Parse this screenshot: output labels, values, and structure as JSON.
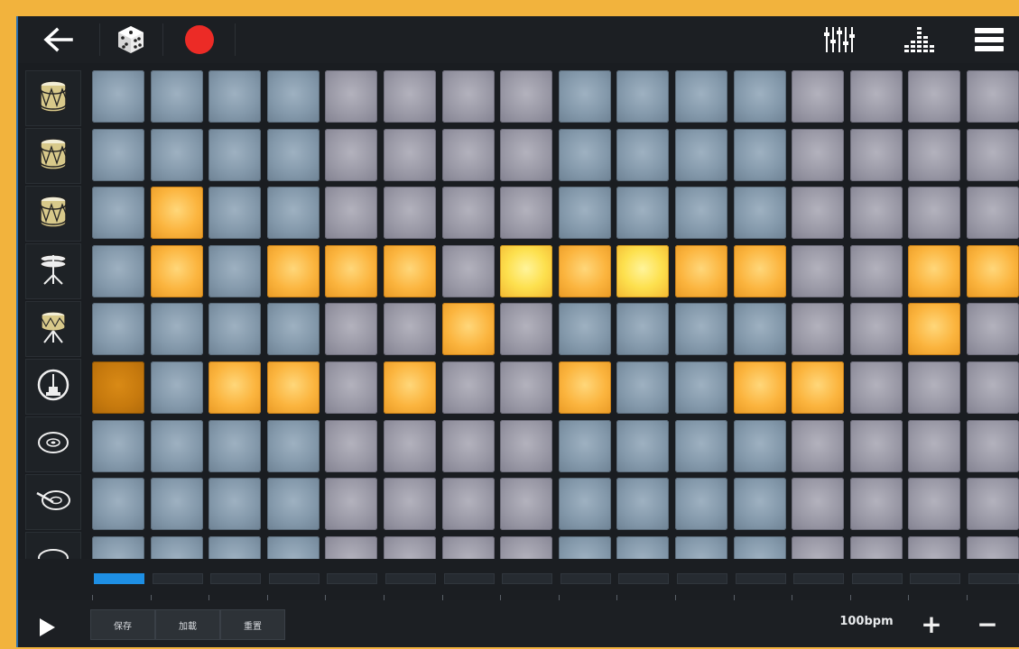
{
  "topbar": {
    "back_icon": "arrow-left-icon",
    "random_icon": "dice-icon",
    "record_icon": "record-icon",
    "mixer_icon": "mixer-sliders-icon",
    "equalizer_icon": "equalizer-icon",
    "menu_icon": "hamburger-menu-icon"
  },
  "instruments": [
    {
      "name": "drum-1-icon"
    },
    {
      "name": "drum-2-icon"
    },
    {
      "name": "drum-3-icon"
    },
    {
      "name": "hihat-icon"
    },
    {
      "name": "snare-stand-icon"
    },
    {
      "name": "kick-icon"
    },
    {
      "name": "cymbal-icon"
    },
    {
      "name": "ride-cymbal-icon"
    },
    {
      "name": "crash-cymbal-icon"
    }
  ],
  "grid": {
    "columns": 16,
    "rows": [
      "bbbbggggbbbbgggg",
      "bbbbggggbbbbgggg",
      "bObbggggbbbbgggg",
      "bObOOOgYOYOOggOO",
      "bbbbggOgbbbbggOg",
      "DbOOgOggObbOOggg",
      "bbbbggggbbbbgggg",
      "bbbbggggbbbbgggg",
      "bbbbggggbbbbgggg"
    ],
    "legend": {
      "b": "blue-off",
      "g": "grey-off",
      "O": "orange-on",
      "Y": "yellow-playing",
      "D": "dark-orange-on"
    }
  },
  "patterns": {
    "count": 16,
    "active_index": 0
  },
  "bottombar": {
    "play_icon": "play-icon",
    "save_label": "保存",
    "load_label": "加載",
    "reset_label": "重置",
    "bpm_label": "100bpm",
    "plus_label": "+",
    "minus_label": "−"
  },
  "colors": {
    "frame": "#f2b33d",
    "background": "#1a1d21",
    "pad_blue": "#8499ab",
    "pad_grey": "#9a99a6",
    "pad_on": "#fbb43e",
    "record": "#ec2b26",
    "pattern_active": "#1e8fe4"
  }
}
